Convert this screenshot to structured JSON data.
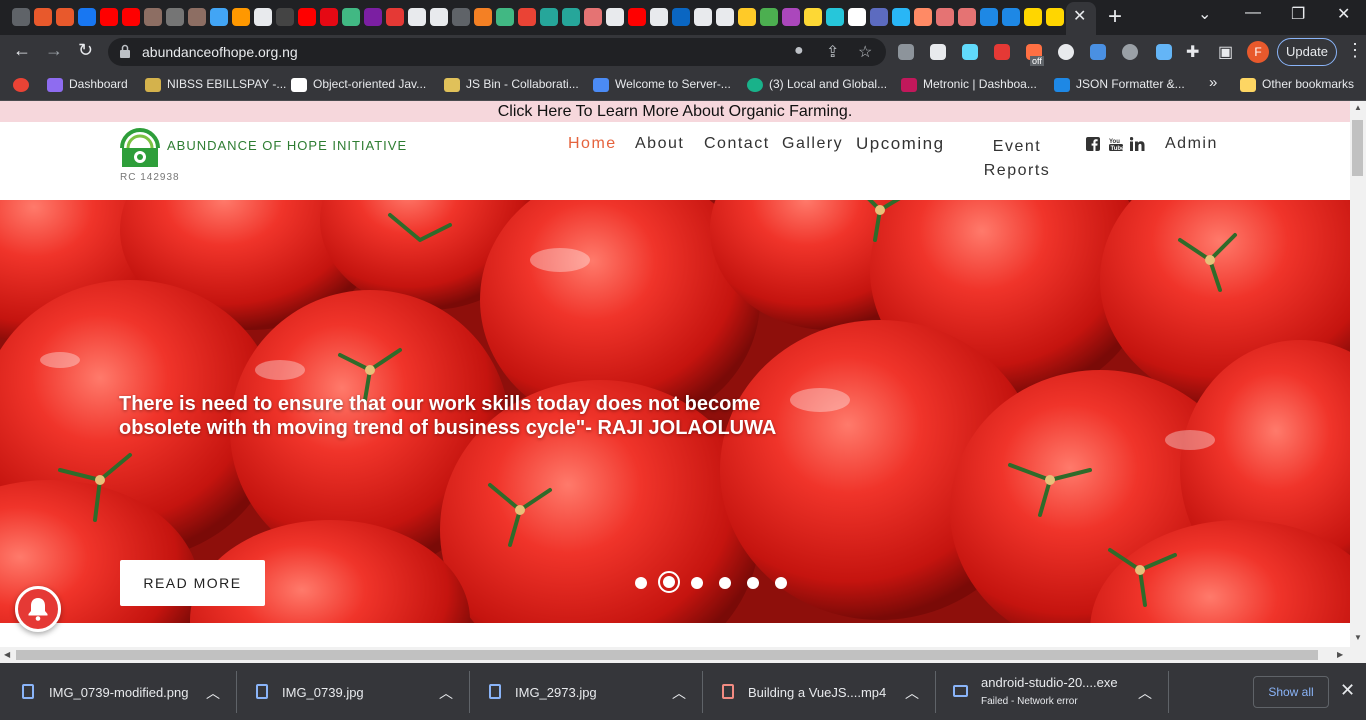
{
  "browser": {
    "url": "abundanceofhope.org.ng",
    "tab_close": "✕",
    "new_tab": "+",
    "profile_initial": "F",
    "update_label": "Update",
    "ext_off_badge": "off",
    "bookmarks": [
      {
        "label": "Dashboard",
        "color": "#8e6cf0"
      },
      {
        "label": "NIBSS EBILLSPAY -...",
        "color": "#d4b24c"
      },
      {
        "label": "Object-oriented Jav...",
        "color": "#ffffff"
      },
      {
        "label": "JS Bin - Collaborati...",
        "color": "#e0c15a"
      },
      {
        "label": "Welcome to Server-...",
        "color": "#4b8bf5"
      },
      {
        "label": "(3) Local and Global...",
        "color": "#19b28a"
      },
      {
        "label": "Metronic | Dashboa...",
        "color": "#c2185b"
      },
      {
        "label": "JSON Formatter &...",
        "color": "#1e88e5"
      }
    ],
    "bookmarks_overflow": "»",
    "other_bookmarks": "Other bookmarks"
  },
  "site": {
    "promo": "Click Here To Learn More About Organic Farming.",
    "brand": "ABUNDANCE OF HOPE INITIATIVE",
    "rc_number": "RC 142938",
    "nav": {
      "home": "Home",
      "about": "About",
      "contact": "Contact",
      "gallery": "Gallery",
      "upcoming": "Upcoming",
      "event_line1": "Event",
      "event_line2": "Reports",
      "admin": "Admin"
    },
    "hero": {
      "quote": "There is need to ensure that our work skills today does not become obsolete with th moving trend of business cycle\"- RAJI JOLAOLUWA",
      "button": "READ MORE",
      "slide_count": 6,
      "active_slide": 2
    }
  },
  "downloads": {
    "items": [
      {
        "name": "IMG_0739-modified.png",
        "status": ""
      },
      {
        "name": "IMG_0739.jpg",
        "status": ""
      },
      {
        "name": "IMG_2973.jpg",
        "status": ""
      },
      {
        "name": "Building a VueJS....mp4",
        "status": ""
      },
      {
        "name": "android-studio-20....exe",
        "status": "Failed - Network error"
      }
    ],
    "show_all": "Show all",
    "close": "✕"
  },
  "colors": {
    "accent_orange": "#e5633d",
    "brand_green": "#2e7d32",
    "promo_pink": "#f6d7dc",
    "tomato_red": "#d32f2f"
  }
}
